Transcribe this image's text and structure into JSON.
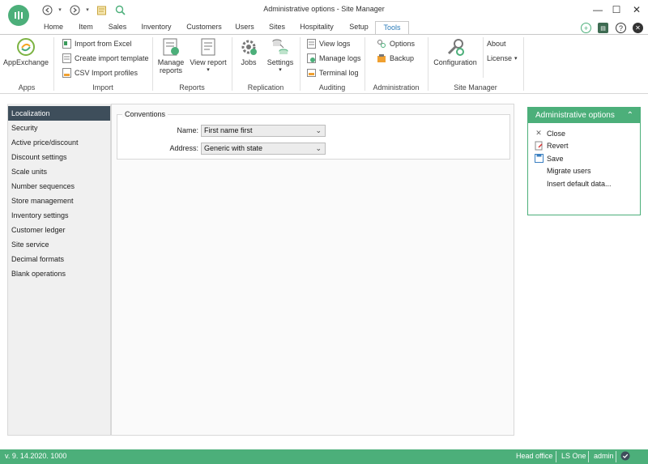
{
  "window": {
    "title": "Administrative options - Site Manager",
    "controls": [
      "minimize",
      "maximize",
      "close"
    ]
  },
  "quick_access": [
    "back-icon",
    "forward-icon",
    "dropdown-icon",
    "notes-icon",
    "search-icon"
  ],
  "tabs": [
    {
      "label": "Home"
    },
    {
      "label": "Item"
    },
    {
      "label": "Sales"
    },
    {
      "label": "Inventory"
    },
    {
      "label": "Customers"
    },
    {
      "label": "Users"
    },
    {
      "label": "Sites"
    },
    {
      "label": "Hospitality"
    },
    {
      "label": "Setup"
    },
    {
      "label": "Tools",
      "active": true
    }
  ],
  "title_icons": [
    "add-circle-icon",
    "store-icon",
    "help-icon",
    "close-circle-icon"
  ],
  "ribbon": {
    "apps": {
      "label": "Apps",
      "appexchange": "AppExchange"
    },
    "import": {
      "label": "Import",
      "from_excel": "Import from Excel",
      "create_template": "Create import template",
      "csv_profiles": "CSV Import profiles"
    },
    "reports": {
      "label": "Reports",
      "manage_reports": "Manage reports",
      "view_report": "View report"
    },
    "replication": {
      "label": "Replication",
      "jobs": "Jobs",
      "settings": "Settings"
    },
    "auditing": {
      "label": "Auditing",
      "view_logs": "View logs",
      "manage_logs": "Manage logs",
      "terminal_log": "Terminal log"
    },
    "administration": {
      "label": "Administration",
      "options": "Options",
      "backup": "Backup"
    },
    "site_manager": {
      "label": "Site Manager",
      "configuration": "Configuration",
      "about": "About",
      "license": "License"
    }
  },
  "nav": [
    {
      "label": "Localization",
      "active": true
    },
    {
      "label": "Security"
    },
    {
      "label": "Active price/discount"
    },
    {
      "label": "Discount settings"
    },
    {
      "label": "Scale units"
    },
    {
      "label": "Number sequences"
    },
    {
      "label": "Store management"
    },
    {
      "label": "Inventory settings"
    },
    {
      "label": "Customer ledger"
    },
    {
      "label": "Site service"
    },
    {
      "label": "Decimal formats"
    },
    {
      "label": "Blank operations"
    }
  ],
  "conventions": {
    "legend": "Conventions",
    "name_label": "Name:",
    "name_value": "First name first",
    "address_label": "Address:",
    "address_value": "Generic with state"
  },
  "side_panel": {
    "title": "Administrative options",
    "actions": [
      {
        "label": "Close",
        "icon": "close-icon"
      },
      {
        "label": "Revert",
        "icon": "revert-icon"
      },
      {
        "label": "Save",
        "icon": "save-icon"
      },
      {
        "label": "Migrate users",
        "icon": ""
      },
      {
        "label": "Insert default data...",
        "icon": ""
      }
    ]
  },
  "status": {
    "version": "v. 9. 14.2020. 1000",
    "location": "Head office",
    "product": "LS One",
    "user": "admin"
  },
  "colors": {
    "accent": "#4caf7a",
    "nav_active": "#3e4e5b",
    "tab_active_text": "#2a7ab8"
  }
}
